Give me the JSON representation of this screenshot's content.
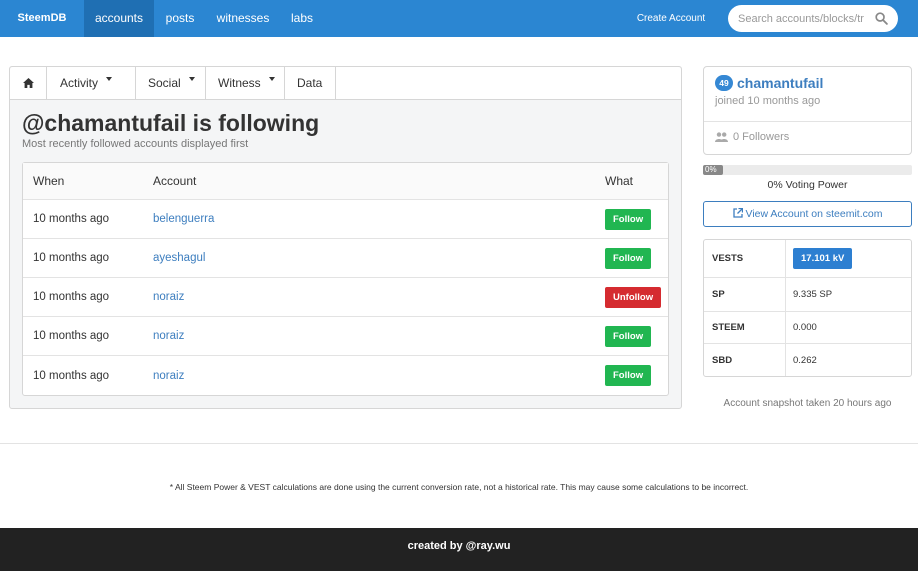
{
  "nav": {
    "brand": "SteemDB",
    "items": [
      {
        "label": "accounts",
        "active": true
      },
      {
        "label": "posts",
        "active": false
      },
      {
        "label": "witnesses",
        "active": false
      },
      {
        "label": "labs",
        "active": false
      }
    ],
    "create_account": "Create Account",
    "search_placeholder": "Search accounts/blocks/tr",
    "search_icon": "search-icon"
  },
  "tabs": {
    "home_icon": "home-icon",
    "items": [
      "Activity",
      "Social",
      "Witness",
      "Data"
    ]
  },
  "main": {
    "title": "@chamantufail is following",
    "subtitle": "Most recently followed accounts displayed first",
    "columns": [
      "When",
      "Account",
      "What"
    ],
    "rows": [
      {
        "when": "10 months ago",
        "account": "belenguerra",
        "what": "Follow"
      },
      {
        "when": "10 months ago",
        "account": "ayeshagul",
        "what": "Follow"
      },
      {
        "when": "10 months ago",
        "account": "noraiz",
        "what": "Unfollow"
      },
      {
        "when": "10 months ago",
        "account": "noraiz",
        "what": "Follow"
      },
      {
        "when": "10 months ago",
        "account": "noraiz",
        "what": "Follow"
      }
    ]
  },
  "profile": {
    "reputation": "49",
    "name": "chamantufail",
    "joined": "joined 10 months ago",
    "followers": "0 Followers",
    "users_icon": "users-icon"
  },
  "voting": {
    "percent_label": "0%",
    "caption": "0% Voting Power",
    "fill_fraction": 0
  },
  "view_button": "View Account on steemit.com",
  "external_icon": "external-link-icon",
  "stats": [
    {
      "key": "VESTS",
      "value": "17.101 kV"
    },
    {
      "key": "SP",
      "value": "9.335 SP"
    },
    {
      "key": "STEEM",
      "value": "0.000"
    },
    {
      "key": "SBD",
      "value": "0.262"
    }
  ],
  "snapshot": "Account snapshot taken 20 hours ago",
  "footnote": "* All Steem Power & VEST calculations are done using the current conversion rate, not a historical rate. This may cause some calculations to be incorrect.",
  "footer": "created by @ray.wu",
  "colors": {
    "nav_bg": "#2b86d2",
    "nav_active": "#1f6fb3",
    "follow": "#21b651",
    "unfollow": "#d52b30",
    "link": "#3d7ebf",
    "footer_bg": "#222222"
  }
}
